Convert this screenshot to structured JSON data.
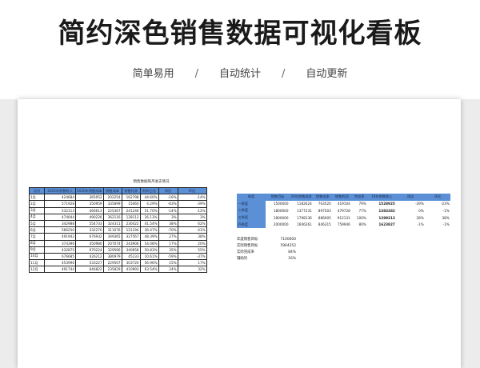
{
  "header": {
    "title": "简约深色销售数据可视化看板",
    "tags": [
      "简单易用",
      "自动统计",
      "自动更新"
    ],
    "separator": "/"
  },
  "monthly_table": {
    "caption": "销售数据每月收支情况",
    "headers": [
      "月份",
      "2020年销售收入",
      "2020年销售成本",
      "销售成本",
      "销售利润",
      "利润占比",
      "",
      "同比",
      "",
      "环比"
    ],
    "rows": [
      [
        "1月",
        "424684",
        "365052",
        "202254",
        "162798",
        "44.60%",
        "-16%",
        "-14%"
      ],
      [
        "2月",
        "571928",
        "350959",
        "335899",
        "15060",
        "4.29%",
        "-63%",
        "-39%"
      ],
      [
        "3月",
        "532113",
        "466613",
        "225367",
        "241246",
        "51.70%",
        "-14%",
        "-12%"
      ],
      [
        "4月",
        "474044",
        "490226",
        "362116",
        "128112",
        "26.13%",
        "3%",
        "3%"
      ],
      [
        "5月",
        "342988",
        "554733",
        "324311",
        "230422",
        "41.54%",
        "38%",
        "62%"
      ],
      [
        "6月",
        "566250",
        "332270",
        "311076",
        "121194",
        "36.47%",
        "-70%",
        "-41%"
      ],
      [
        "7月",
        "491942",
        "676932",
        "349365",
        "327567",
        "48.39%",
        "27%",
        "38%"
      ],
      [
        "8月",
        "374396",
        "450980",
        "207074",
        "243906",
        "54.08%",
        "17%",
        "20%"
      ],
      [
        "9月",
        "432875",
        "670224",
        "329566",
        "340658",
        "50.83%",
        "35%",
        "55%"
      ],
      [
        "10月",
        "676685",
        "426212",
        "380979",
        "45233",
        "10.61%",
        "-59%",
        "-37%"
      ],
      [
        "11月",
        "453996",
        "533227",
        "229507",
        "303720",
        "56.96%",
        "15%",
        "17%"
      ],
      [
        "12月",
        "491744",
        "646822",
        "235829",
        "410993",
        "63.54%",
        "24%",
        "32%"
      ]
    ]
  },
  "quarter_table": {
    "headers": [
      "季度",
      "销售目标",
      "20年销售成本",
      "销售成本",
      "销售利润",
      "完成率",
      "19年销售收入",
      "",
      "同比",
      "",
      "环比"
    ],
    "rows": [
      [
        "一季度",
        "1500000",
        "1182624",
        "763520",
        "419104",
        "79%",
        "1528925",
        "-29%",
        "-23%"
      ],
      [
        "二季度",
        "1800000",
        "1377231",
        "897503",
        "479728",
        "77%",
        "1383282",
        "0%",
        "-1%"
      ],
      [
        "三季度",
        "1800000",
        "1798136",
        "886005",
        "912131",
        "100%",
        "1299213",
        "28%",
        "38%"
      ],
      [
        "四季度",
        "2000000",
        "1606261",
        "846315",
        "759946",
        "80%",
        "1623827",
        "-1%",
        "-1%"
      ]
    ]
  },
  "summary": [
    {
      "label": "年度销售目标",
      "value": "7100000"
    },
    {
      "label": "实际销售目标",
      "value": "5964252"
    },
    {
      "label": "实际完成率",
      "value": "84%"
    },
    {
      "label": "辅助列",
      "value": "16%"
    }
  ]
}
